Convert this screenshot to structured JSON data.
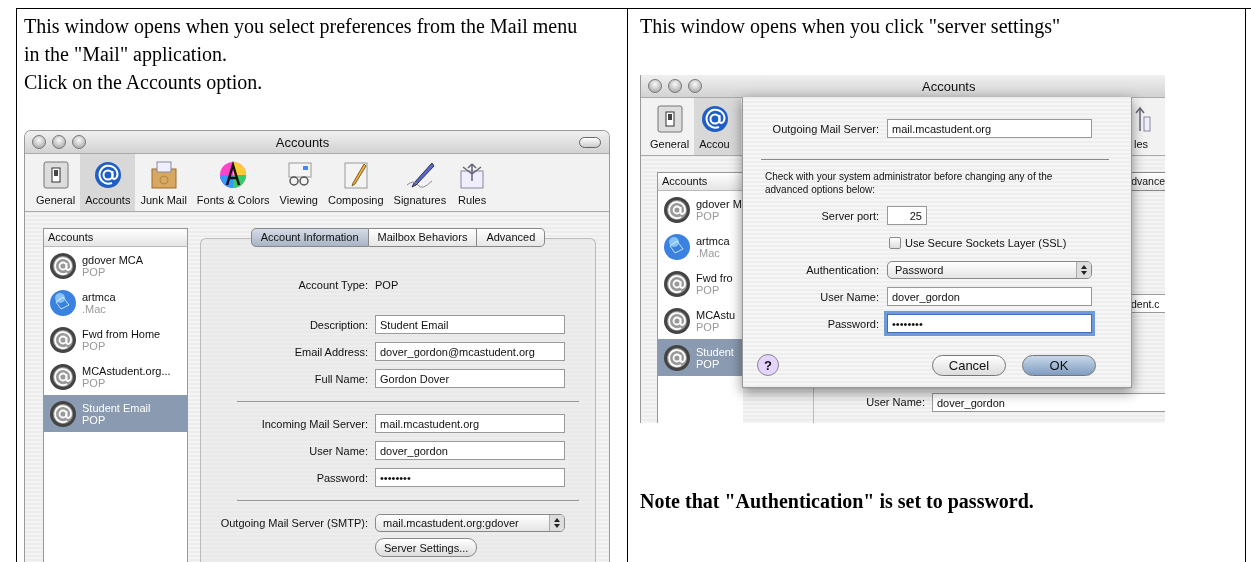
{
  "left_cell": {
    "paragraphs": [
      "This window opens when you select preferences from the Mail menu in the \"Mail\" application.",
      "Click on the Accounts option."
    ],
    "screenshot": {
      "title": "Accounts",
      "toolbar": [
        {
          "label": "General",
          "selected": false
        },
        {
          "label": "Accounts",
          "selected": true
        },
        {
          "label": "Junk Mail",
          "selected": false
        },
        {
          "label": "Fonts & Colors",
          "selected": false
        },
        {
          "label": "Viewing",
          "selected": false
        },
        {
          "label": "Composing",
          "selected": false
        },
        {
          "label": "Signatures",
          "selected": false
        },
        {
          "label": "Rules",
          "selected": false
        }
      ],
      "sidebar": {
        "header": "Accounts",
        "items": [
          {
            "name": "gdover MCA",
            "type": "POP",
            "kind": "pop",
            "selected": false
          },
          {
            "name": "artmca",
            "type": ".Mac",
            "kind": "dotmac",
            "selected": false
          },
          {
            "name": "Fwd from Home",
            "type": "POP",
            "kind": "pop",
            "selected": false
          },
          {
            "name": "MCAstudent.org...",
            "type": "POP",
            "kind": "pop",
            "selected": false
          },
          {
            "name": "Student Email",
            "type": "POP",
            "kind": "pop",
            "selected": true
          }
        ]
      },
      "tabs": [
        {
          "label": "Account Information",
          "selected": true
        },
        {
          "label": "Mailbox Behaviors",
          "selected": false
        },
        {
          "label": "Advanced",
          "selected": false
        }
      ],
      "form": [
        {
          "kind": "static",
          "label": "Account Type:",
          "value": "POP"
        },
        {
          "kind": "text",
          "label": "Description:",
          "value": "Student Email"
        },
        {
          "kind": "text",
          "label": "Email Address:",
          "value": "dover_gordon@mcastudent.org"
        },
        {
          "kind": "text",
          "label": "Full Name:",
          "value": "Gordon Dover"
        },
        {
          "kind": "divider"
        },
        {
          "kind": "text",
          "label": "Incoming Mail Server:",
          "value": "mail.mcastudent.org"
        },
        {
          "kind": "text",
          "label": "User Name:",
          "value": "dover_gordon"
        },
        {
          "kind": "password",
          "label": "Password:",
          "value": "••••••••"
        },
        {
          "kind": "divider"
        },
        {
          "kind": "popup",
          "label": "Outgoing Mail Server (SMTP):",
          "value": "mail.mcastudent.org:gdover"
        },
        {
          "kind": "button",
          "value": "Server Settings..."
        }
      ]
    }
  },
  "right_cell": {
    "paragraphs": [
      "This window opens when you click \"server settings\""
    ],
    "screenshot": {
      "title": "Accounts",
      "toolbar": [
        {
          "label": "General",
          "selected": false
        },
        {
          "label": "Accou",
          "selected": true
        },
        {
          "label": "les",
          "selected": false
        }
      ],
      "sidebar": {
        "header": "Accounts",
        "items": [
          {
            "name": "gdover M",
            "type": "POP",
            "kind": "pop",
            "selected": false
          },
          {
            "name": "artmca",
            "type": ".Mac",
            "kind": "dotmac",
            "selected": false
          },
          {
            "name": "Fwd fro",
            "type": "POP",
            "kind": "pop",
            "selected": false
          },
          {
            "name": "MCAstu",
            "type": "POP",
            "kind": "pop",
            "selected": false
          },
          {
            "name": "Student",
            "type": "POP",
            "kind": "pop",
            "selected": true
          }
        ]
      },
      "tab": "dvance",
      "field_fragment": "dent.c",
      "user_name": {
        "label": "User Name:",
        "value": "dover_gordon"
      },
      "sheet": {
        "rows": [
          {
            "kind": "text",
            "label": "Outgoing Mail Server:",
            "value": "mail.mcastudent.org",
            "focused": false
          },
          {
            "kind": "divider"
          },
          {
            "kind": "note",
            "text": "Check with your system administrator before changing any of the advanced options below:"
          },
          {
            "kind": "port",
            "label": "Server port:",
            "value": "25"
          },
          {
            "kind": "checkbox",
            "label": "Use Secure Sockets Layer (SSL)",
            "checked": false
          },
          {
            "kind": "popup",
            "label": "Authentication:",
            "value": "Password"
          },
          {
            "kind": "text",
            "label": "User Name:",
            "value": "dover_gordon",
            "focused": false
          },
          {
            "kind": "password",
            "label": "Password:",
            "value": "••••••••",
            "focused": true
          }
        ],
        "help": "?",
        "buttons": [
          {
            "label": "Cancel",
            "default": false
          },
          {
            "label": "OK",
            "default": true
          }
        ]
      }
    },
    "note": "Note that \"Authentication\" is set to password."
  }
}
